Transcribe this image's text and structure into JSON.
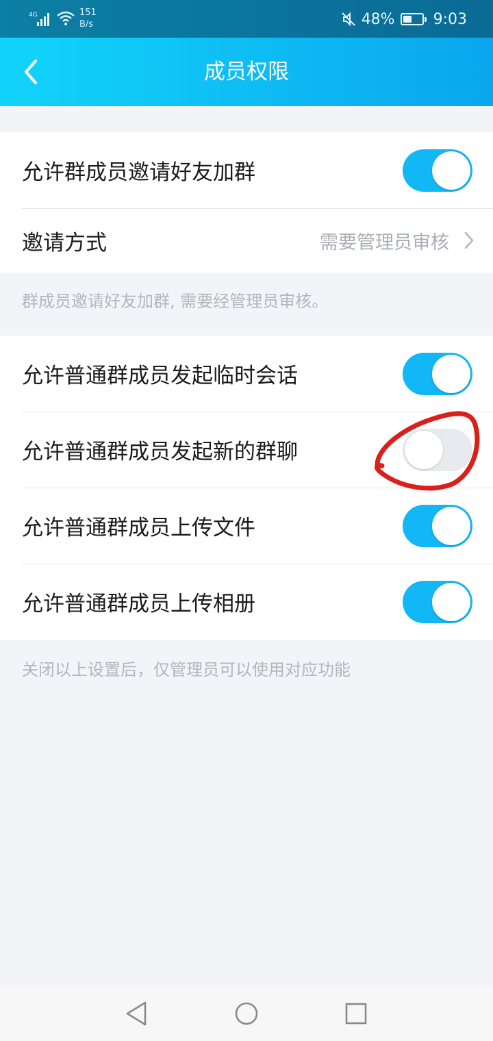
{
  "status_bar": {
    "network": "4G",
    "speed_value": "151",
    "speed_unit": "B/s",
    "battery": "48%",
    "battery_level": 0.48,
    "time": "9:03",
    "icons": [
      "signal-icon",
      "wifi-icon",
      "mute-icon",
      "battery-icon"
    ]
  },
  "header": {
    "title": "成员权限",
    "back_icon": "chevron-left-icon"
  },
  "invite_section": {
    "allow_invite": {
      "label": "允许群成员邀请好友加群",
      "enabled": true
    },
    "invite_method": {
      "label": "邀请方式",
      "value": "需要管理员审核",
      "chevron_icon": "chevron-right-icon"
    },
    "note": "群成员邀请好友加群, 需要经管理员审核。"
  },
  "member_section": {
    "items": [
      {
        "label": "允许普通群成员发起临时会话",
        "enabled": true
      },
      {
        "label": "允许普通群成员发起新的群聊",
        "enabled": false
      },
      {
        "label": "允许普通群成员上传文件",
        "enabled": true
      },
      {
        "label": "允许普通群成员上传相册",
        "enabled": true
      }
    ],
    "note": "关闭以上设置后，仅管理员可以使用对应功能"
  },
  "colors": {
    "accent": "#12b7f5",
    "header_gradient_start": "#12d4fb",
    "header_gradient_end": "#0aa6ee",
    "annotation": "#d9201a"
  },
  "nav_bar": {
    "icons": [
      "nav-back-icon",
      "nav-home-icon",
      "nav-recents-icon"
    ]
  }
}
